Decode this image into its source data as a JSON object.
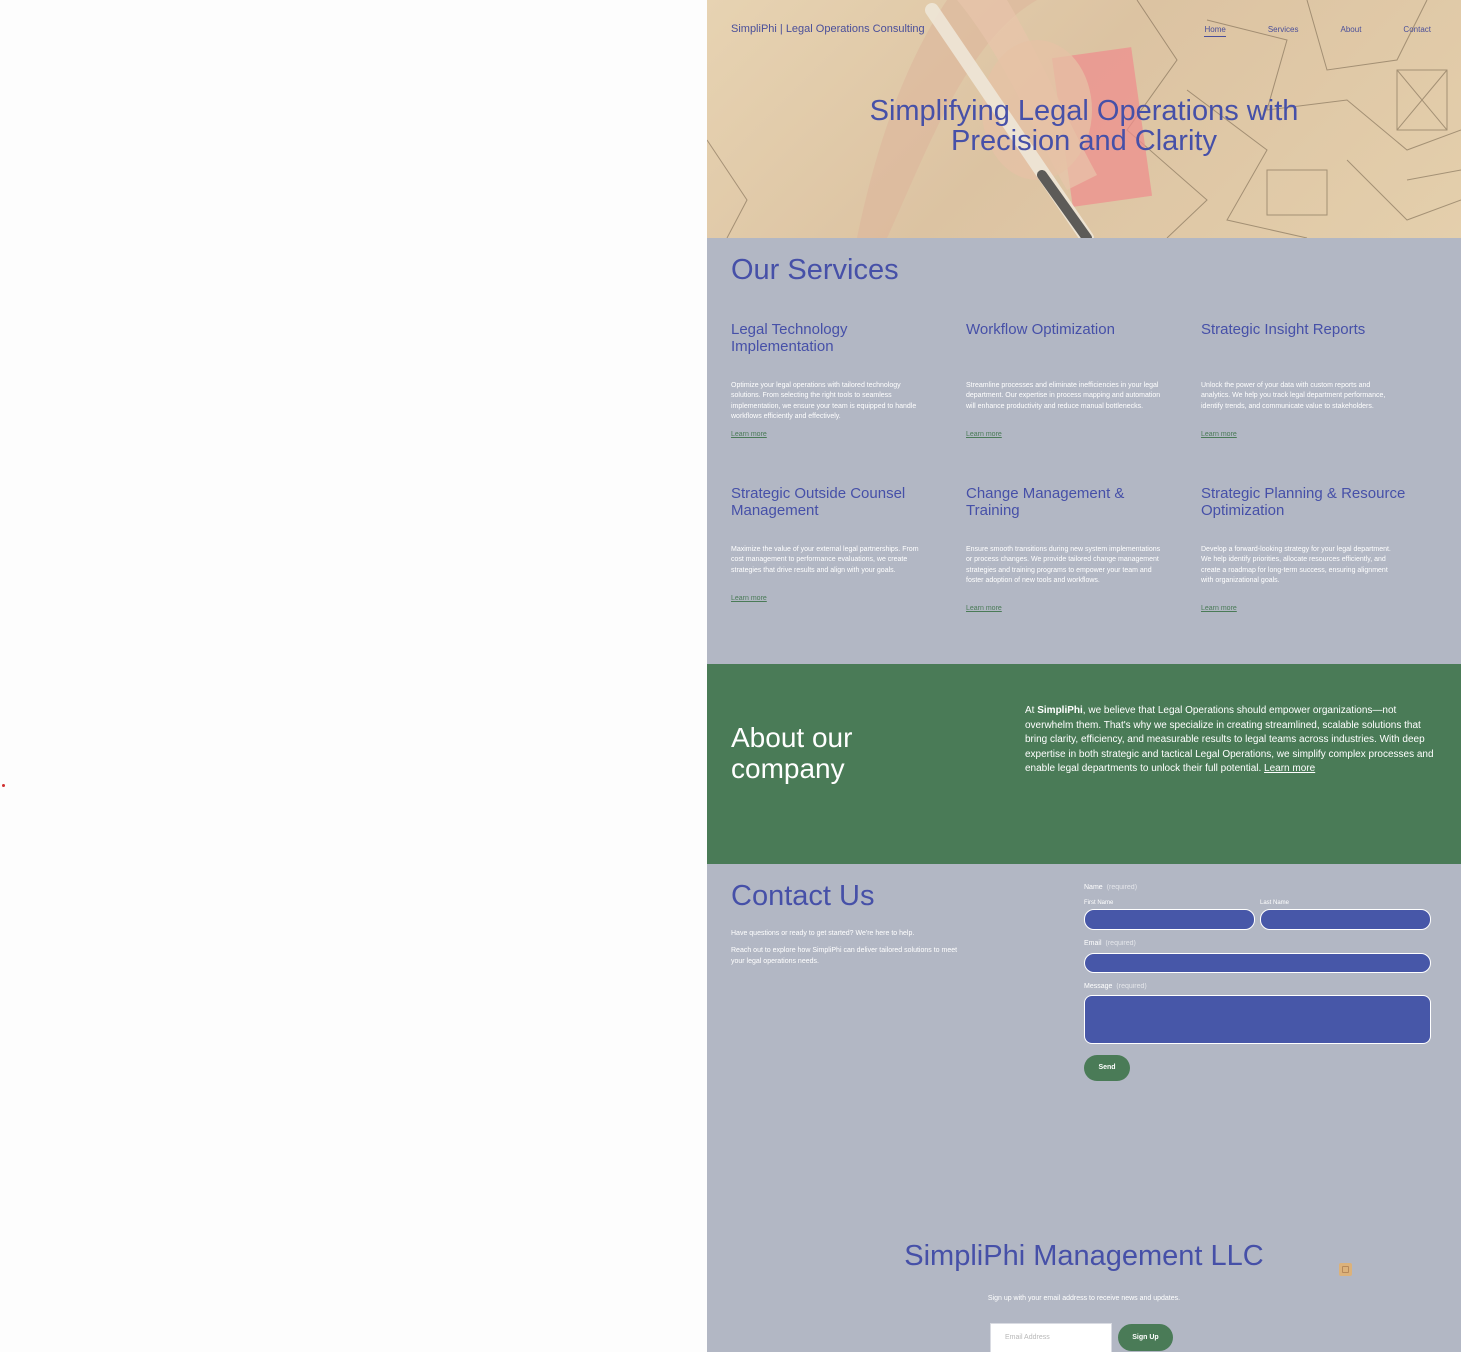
{
  "header": {
    "brand": "SimpliPhi | Legal Operations Consulting",
    "nav": [
      {
        "label": "Home",
        "active": true
      },
      {
        "label": "Services",
        "active": false
      },
      {
        "label": "About",
        "active": false
      },
      {
        "label": "Contact",
        "active": false
      }
    ]
  },
  "hero": {
    "title_line1": "Simplifying Legal Operations with",
    "title_line2": "Precision and Clarity"
  },
  "services": {
    "title": "Our Services",
    "items": [
      {
        "title": "Legal Technology Implementation",
        "desc": "Optimize your legal operations with tailored technology solutions. From selecting the right tools to seamless implementation, we ensure your team is equipped to handle workflows efficiently and effectively.",
        "link": "Learn more"
      },
      {
        "title": "Workflow Optimization",
        "desc": "Streamline processes and eliminate inefficiencies in your legal department. Our expertise in process mapping and automation will enhance productivity and reduce manual bottlenecks.",
        "link": "Learn more"
      },
      {
        "title": "Strategic Insight Reports",
        "desc": "Unlock the power of your data with custom reports and analytics. We help you track legal department performance, identify trends, and communicate value to stakeholders.",
        "link": "Learn more"
      },
      {
        "title": "Strategic Outside Counsel Management",
        "desc": "Maximize the value of your external legal partnerships. From cost management to performance evaluations, we create strategies that drive results and align with your goals.",
        "link": "Learn more"
      },
      {
        "title": "Change Management & Training",
        "desc": "Ensure smooth transitions during new system implementations or process changes. We provide tailored change management strategies and training programs to empower your team and foster adoption of new tools and workflows.",
        "link": "Learn more"
      },
      {
        "title": "Strategic Planning & Resource Optimization",
        "desc": "Develop a forward-looking strategy for your legal department. We help identify priorities, allocate resources efficiently, and create a roadmap for long-term success, ensuring alignment with organizational goals.",
        "link": "Learn more"
      }
    ]
  },
  "about": {
    "title": "About our company",
    "text_prefix": "At ",
    "brand_bold": "SimpliPhi",
    "text_body": ", we believe that Legal Operations should empower organizations—not overwhelm them. That's why we specialize in creating streamlined, scalable solutions that bring clarity, efficiency, and measurable results to legal teams across industries. With deep expertise in both strategic and tactical Legal Operations, we simplify complex processes and enable legal departments to unlock their full potential. ",
    "link": "Learn more"
  },
  "contact": {
    "title": "Contact Us",
    "text1": "Have questions or ready to get started? We're here to help.",
    "text2": "Reach out to explore how SimpliPhi can deliver tailored solutions to meet your legal operations needs.",
    "name_label": "Name",
    "required": "(required)",
    "first_name_label": "First Name",
    "last_name_label": "Last Name",
    "email_label": "Email",
    "message_label": "Message",
    "send_label": "Send"
  },
  "footer": {
    "title": "SimpliPhi Management LLC",
    "subtitle": "Sign up with your email address to receive news and updates.",
    "email_placeholder": "Email Address",
    "signup_label": "Sign Up"
  },
  "colors": {
    "primary_blue": "#4650a8",
    "green": "#4a7b57",
    "section_gray": "#b2b7c4",
    "field_blue": "#4757a8"
  }
}
